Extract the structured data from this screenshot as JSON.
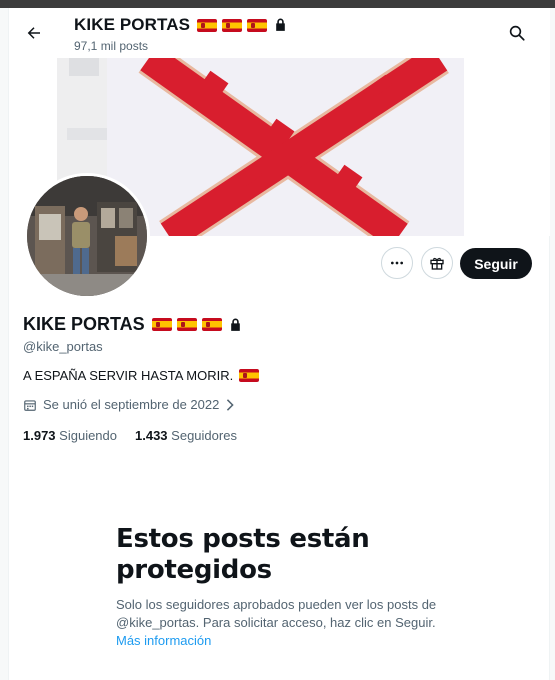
{
  "header": {
    "name": "KIKE PORTAS",
    "posts_count": "97,1 mil posts"
  },
  "profile": {
    "name": "KIKE PORTAS",
    "handle": "@kike_portas",
    "bio": "A ESPAÑA SERVIR HASTA MORIR.",
    "joined": "Se unió el septiembre de 2022",
    "following_count": "1.973",
    "following_label": "Siguiendo",
    "followers_count": "1.433",
    "followers_label": "Seguidores"
  },
  "actions": {
    "follow_label": "Seguir"
  },
  "protected_notice": {
    "title": "Estos posts están protegidos",
    "body": "Solo los seguidores aprobados pueden ver los posts de @kike_portas. Para solicitar acceso, haz clic en Seguir.",
    "link": "Más información"
  },
  "colors": {
    "accent": "#1d9bf0",
    "text": "#0f1419",
    "secondary": "#536471",
    "flag_red": "#c60b1e",
    "flag_yellow": "#ffc400",
    "banner_cross": "#d81e2e"
  },
  "icons": [
    "back-arrow-icon",
    "search-icon",
    "spain-flag-icon",
    "lock-icon",
    "more-icon",
    "gift-icon",
    "calendar-icon",
    "chevron-right-icon"
  ]
}
